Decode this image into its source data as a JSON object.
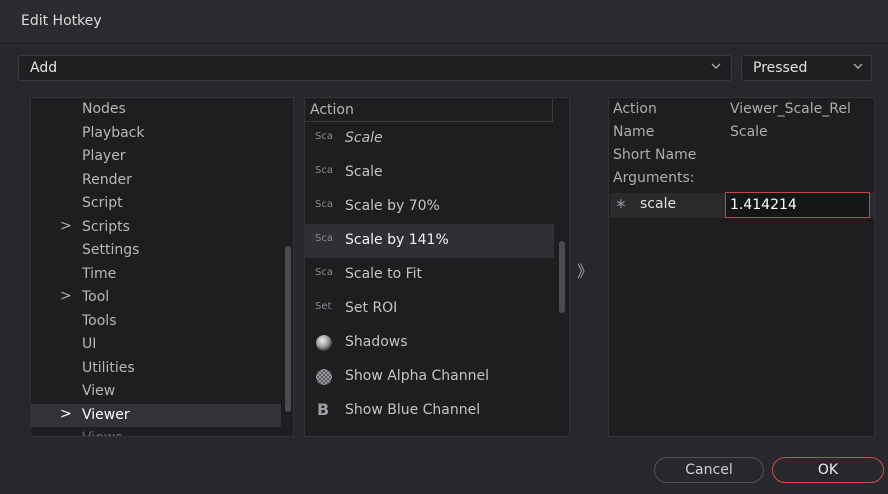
{
  "window": {
    "title": "Edit Hotkey"
  },
  "toolbar": {
    "action_dropdown": "Add",
    "state_dropdown": "Pressed"
  },
  "categories": {
    "items": [
      {
        "label": "Nodes",
        "expandable": false
      },
      {
        "label": "Playback",
        "expandable": false
      },
      {
        "label": "Player",
        "expandable": false
      },
      {
        "label": "Render",
        "expandable": false
      },
      {
        "label": "Script",
        "expandable": false
      },
      {
        "label": "Scripts",
        "expandable": true
      },
      {
        "label": "Settings",
        "expandable": false
      },
      {
        "label": "Time",
        "expandable": false
      },
      {
        "label": "Tool",
        "expandable": true
      },
      {
        "label": "Tools",
        "expandable": false
      },
      {
        "label": "UI",
        "expandable": false
      },
      {
        "label": "Utilities",
        "expandable": false
      },
      {
        "label": "View",
        "expandable": false
      },
      {
        "label": "Viewer",
        "expandable": true,
        "selected": true
      },
      {
        "label": "Views",
        "expandable": false
      }
    ],
    "arrow_glyph": ">"
  },
  "actions": {
    "header": "Action",
    "items": [
      {
        "abbr": "Sca",
        "label": "Scale",
        "italic": true
      },
      {
        "abbr": "Sca",
        "label": "Scale"
      },
      {
        "abbr": "Sca",
        "label": "Scale by 70%"
      },
      {
        "abbr": "Sca",
        "label": "Scale by 141%",
        "selected": true
      },
      {
        "abbr": "Sca",
        "label": "Scale to Fit"
      },
      {
        "abbr": "Set",
        "label": "Set ROI"
      },
      {
        "icon": "sphere-icon",
        "label": "Shadows"
      },
      {
        "icon": "checker-icon",
        "label": "Show Alpha Channel"
      },
      {
        "icon": "letter-b-icon",
        "letter": "B",
        "label": "Show Blue Channel"
      }
    ]
  },
  "expander_glyph": "》",
  "details": {
    "action_key": "Action",
    "action_value": "Viewer_Scale_Rel",
    "name_key": "Name",
    "name_value": "Scale",
    "short_name_key": "Short Name",
    "arguments_key": "Arguments:",
    "argument": {
      "marker": "∗",
      "name": "scale",
      "value": "1.414214"
    }
  },
  "footer": {
    "cancel_label": "Cancel",
    "ok_label": "OK"
  },
  "colors": {
    "background": "#28282c",
    "panel": "#1e1e21",
    "accent_red": "#c84848",
    "selection": "#303034"
  }
}
